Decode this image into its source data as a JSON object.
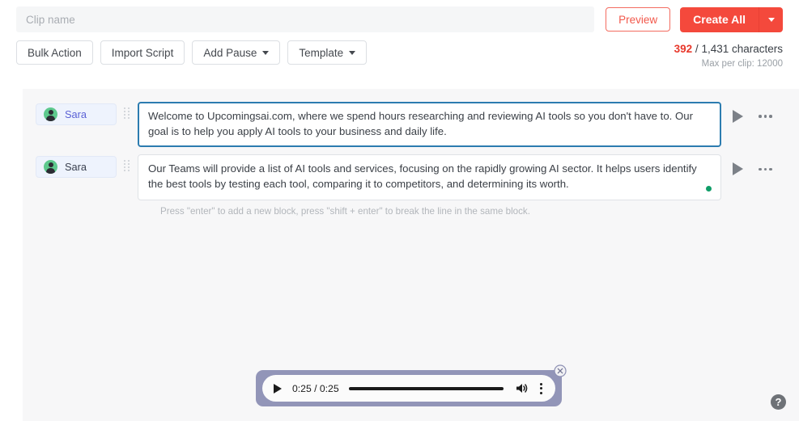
{
  "header": {
    "clip_name_placeholder": "Clip name",
    "clip_name_value": "",
    "preview_label": "Preview",
    "create_all_label": "Create All",
    "create_all_caret_icon": "chevron-down-icon"
  },
  "toolbar": {
    "bulk_action_label": "Bulk Action",
    "import_script_label": "Import Script",
    "add_pause_label": "Add Pause",
    "template_label": "Template",
    "caret_icon": "chevron-down-icon"
  },
  "character_counter": {
    "used": "392",
    "separator": " / ",
    "total": "1,431 characters",
    "max_per_clip": "Max per clip: 12000",
    "used_color": "#e8372a"
  },
  "blocks": [
    {
      "speaker": "Sara",
      "avatar_icon": "user-avatar-icon",
      "drag_handle_icon": "drag-handle-icon",
      "text": "Welcome to Upcomingsai.com, where we spend hours researching and reviewing AI tools so you don't have to. Our goal is to help you apply AI tools to your business and daily life.",
      "focused": true,
      "has_status_dot": false,
      "play_icon": "play-icon",
      "menu_icon": "more-horizontal-icon"
    },
    {
      "speaker": "Sara",
      "avatar_icon": "user-avatar-icon",
      "drag_handle_icon": "drag-handle-icon",
      "text": "Our Teams will provide a list of AI tools and services, focusing on the rapidly growing AI sector. It helps users identify the best tools by testing each tool, comparing it to competitors, and determining its worth.",
      "focused": false,
      "has_status_dot": true,
      "status_dot_color": "#0f9d68",
      "play_icon": "play-icon",
      "menu_icon": "more-horizontal-icon"
    }
  ],
  "hint": "Press \"enter\" to add a new block, press \"shift + enter\" to break the line in the same block.",
  "audio_player": {
    "play_icon": "play-icon",
    "time_display": "0:25 / 0:25",
    "volume_icon": "volume-high-icon",
    "menu_icon": "more-vertical-icon",
    "close_icon": "close-circle-icon",
    "progress_percent": 100
  },
  "help": {
    "label": "?",
    "icon": "help-circle-icon"
  }
}
